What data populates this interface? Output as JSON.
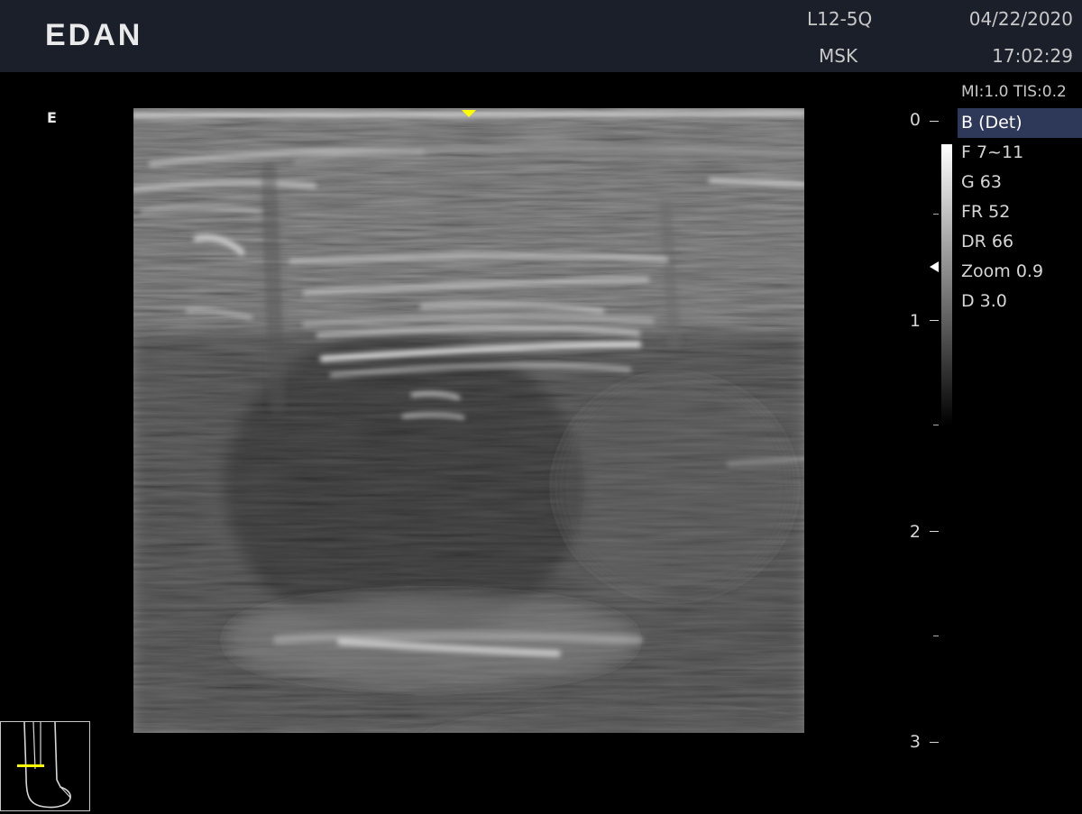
{
  "header": {
    "logo": "EDAN",
    "probe": "L12-5Q",
    "preset": "MSK",
    "date": "04/22/2020",
    "time": "17:02:29"
  },
  "indices": {
    "mi_tis": "MI:1.0   TIS:0.2"
  },
  "image": {
    "mode_marker": "E"
  },
  "depth_scale": {
    "labels": [
      "0",
      "1",
      "2",
      "3"
    ],
    "max": 3,
    "unit_hidden": true
  },
  "params": {
    "mode": "B (Det)",
    "frequency": "F 7~11",
    "gain": "G 63",
    "frame_rate": "FR 52",
    "dynamic_range": "DR 66",
    "zoom": "Zoom 0.9",
    "depth": "D 3.0"
  },
  "colors": {
    "header_bg": "#1b1f29",
    "active_param_bg": "#2e3858",
    "marker": "#ffff00"
  },
  "icons": {
    "orientation": "yellow-triangle-icon",
    "focus": "focus-arrow-icon",
    "body_mark": "ankle-bodymark-icon"
  }
}
